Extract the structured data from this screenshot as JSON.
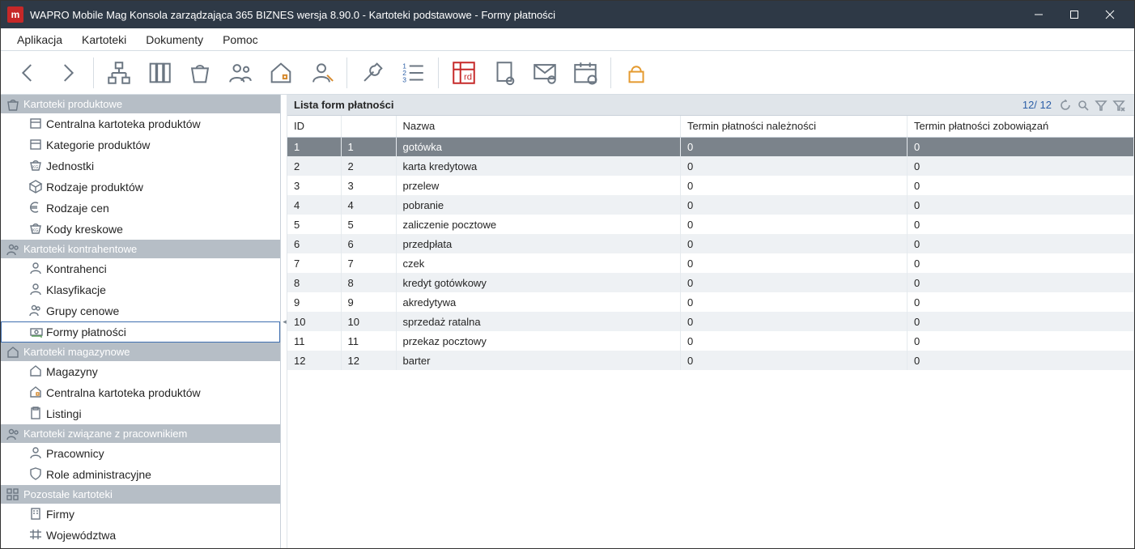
{
  "titlebar": {
    "logo_text": "m",
    "title": "WAPRO Mobile Mag Konsola zarządzająca 365 BIZNES wersja 8.90.0 - Kartoteki podstawowe - Formy płatności"
  },
  "menu": {
    "items": [
      "Aplikacja",
      "Kartoteki",
      "Dokumenty",
      "Pomoc"
    ]
  },
  "toolbar_icons": [
    "nav-back",
    "nav-forward",
    "sep",
    "network",
    "binders",
    "bag",
    "contacts",
    "home",
    "users",
    "sep",
    "wrench",
    "numbered-list",
    "sep",
    "rd",
    "page",
    "mail",
    "calendar",
    "sep",
    "lock"
  ],
  "sidebar": {
    "groups": [
      {
        "label": "Kartoteki produktowe",
        "icon": "bag",
        "items": [
          {
            "label": "Centralna kartoteka produktów",
            "icon": "box-orange"
          },
          {
            "label": "Kategorie produktów",
            "icon": "box-orange"
          },
          {
            "label": "Jednostki",
            "icon": "scale"
          },
          {
            "label": "Rodzaje produktów",
            "icon": "cube-blue"
          },
          {
            "label": "Rodzaje cen",
            "icon": "euro"
          },
          {
            "label": "Kody kreskowe",
            "icon": "scale"
          }
        ]
      },
      {
        "label": "Kartoteki kontrahentowe",
        "icon": "users",
        "items": [
          {
            "label": "Kontrahenci",
            "icon": "person"
          },
          {
            "label": "Klasyfikacje",
            "icon": "person"
          },
          {
            "label": "Grupy cenowe",
            "icon": "users-blue"
          },
          {
            "label": "Formy płatności",
            "icon": "cash",
            "selected": true
          }
        ]
      },
      {
        "label": "Kartoteki magazynowe",
        "icon": "home",
        "items": [
          {
            "label": "Magazyny",
            "icon": "home-plain"
          },
          {
            "label": "Centralna kartoteka produktów",
            "icon": "home-orange"
          },
          {
            "label": "Listingi",
            "icon": "clipboard"
          }
        ]
      },
      {
        "label": "Kartoteki związane z pracownikiem",
        "icon": "users",
        "items": [
          {
            "label": "Pracownicy",
            "icon": "person"
          },
          {
            "label": "Role administracyjne",
            "icon": "shield-blue"
          }
        ]
      },
      {
        "label": "Pozostałe kartoteki",
        "icon": "grid-orange",
        "items": [
          {
            "label": "Firmy",
            "icon": "building-blue"
          },
          {
            "label": "Województwa",
            "icon": "roads"
          }
        ]
      }
    ]
  },
  "list": {
    "title": "Lista form płatności",
    "count": "12/ 12",
    "columns": [
      "ID",
      "",
      "Nazwa",
      "Termin płatności należności",
      "Termin płatności zobowiązań"
    ],
    "rows": [
      {
        "id": "1",
        "idx": "1",
        "name": "gotówka",
        "t1": "0",
        "t2": "0",
        "selected": true
      },
      {
        "id": "2",
        "idx": "2",
        "name": "karta kredytowa",
        "t1": "0",
        "t2": "0"
      },
      {
        "id": "3",
        "idx": "3",
        "name": "przelew",
        "t1": "0",
        "t2": "0"
      },
      {
        "id": "4",
        "idx": "4",
        "name": "pobranie",
        "t1": "0",
        "t2": "0"
      },
      {
        "id": "5",
        "idx": "5",
        "name": "zaliczenie pocztowe",
        "t1": "0",
        "t2": "0"
      },
      {
        "id": "6",
        "idx": "6",
        "name": "przedpłata",
        "t1": "0",
        "t2": "0"
      },
      {
        "id": "7",
        "idx": "7",
        "name": "czek",
        "t1": "0",
        "t2": "0"
      },
      {
        "id": "8",
        "idx": "8",
        "name": "kredyt gotówkowy",
        "t1": "0",
        "t2": "0"
      },
      {
        "id": "9",
        "idx": "9",
        "name": "akredytywa",
        "t1": "0",
        "t2": "0"
      },
      {
        "id": "10",
        "idx": "10",
        "name": "sprzedaż ratalna",
        "t1": "0",
        "t2": "0"
      },
      {
        "id": "11",
        "idx": "11",
        "name": "przekaz pocztowy",
        "t1": "0",
        "t2": "0"
      },
      {
        "id": "12",
        "idx": "12",
        "name": "barter",
        "t1": "0",
        "t2": "0"
      }
    ]
  }
}
